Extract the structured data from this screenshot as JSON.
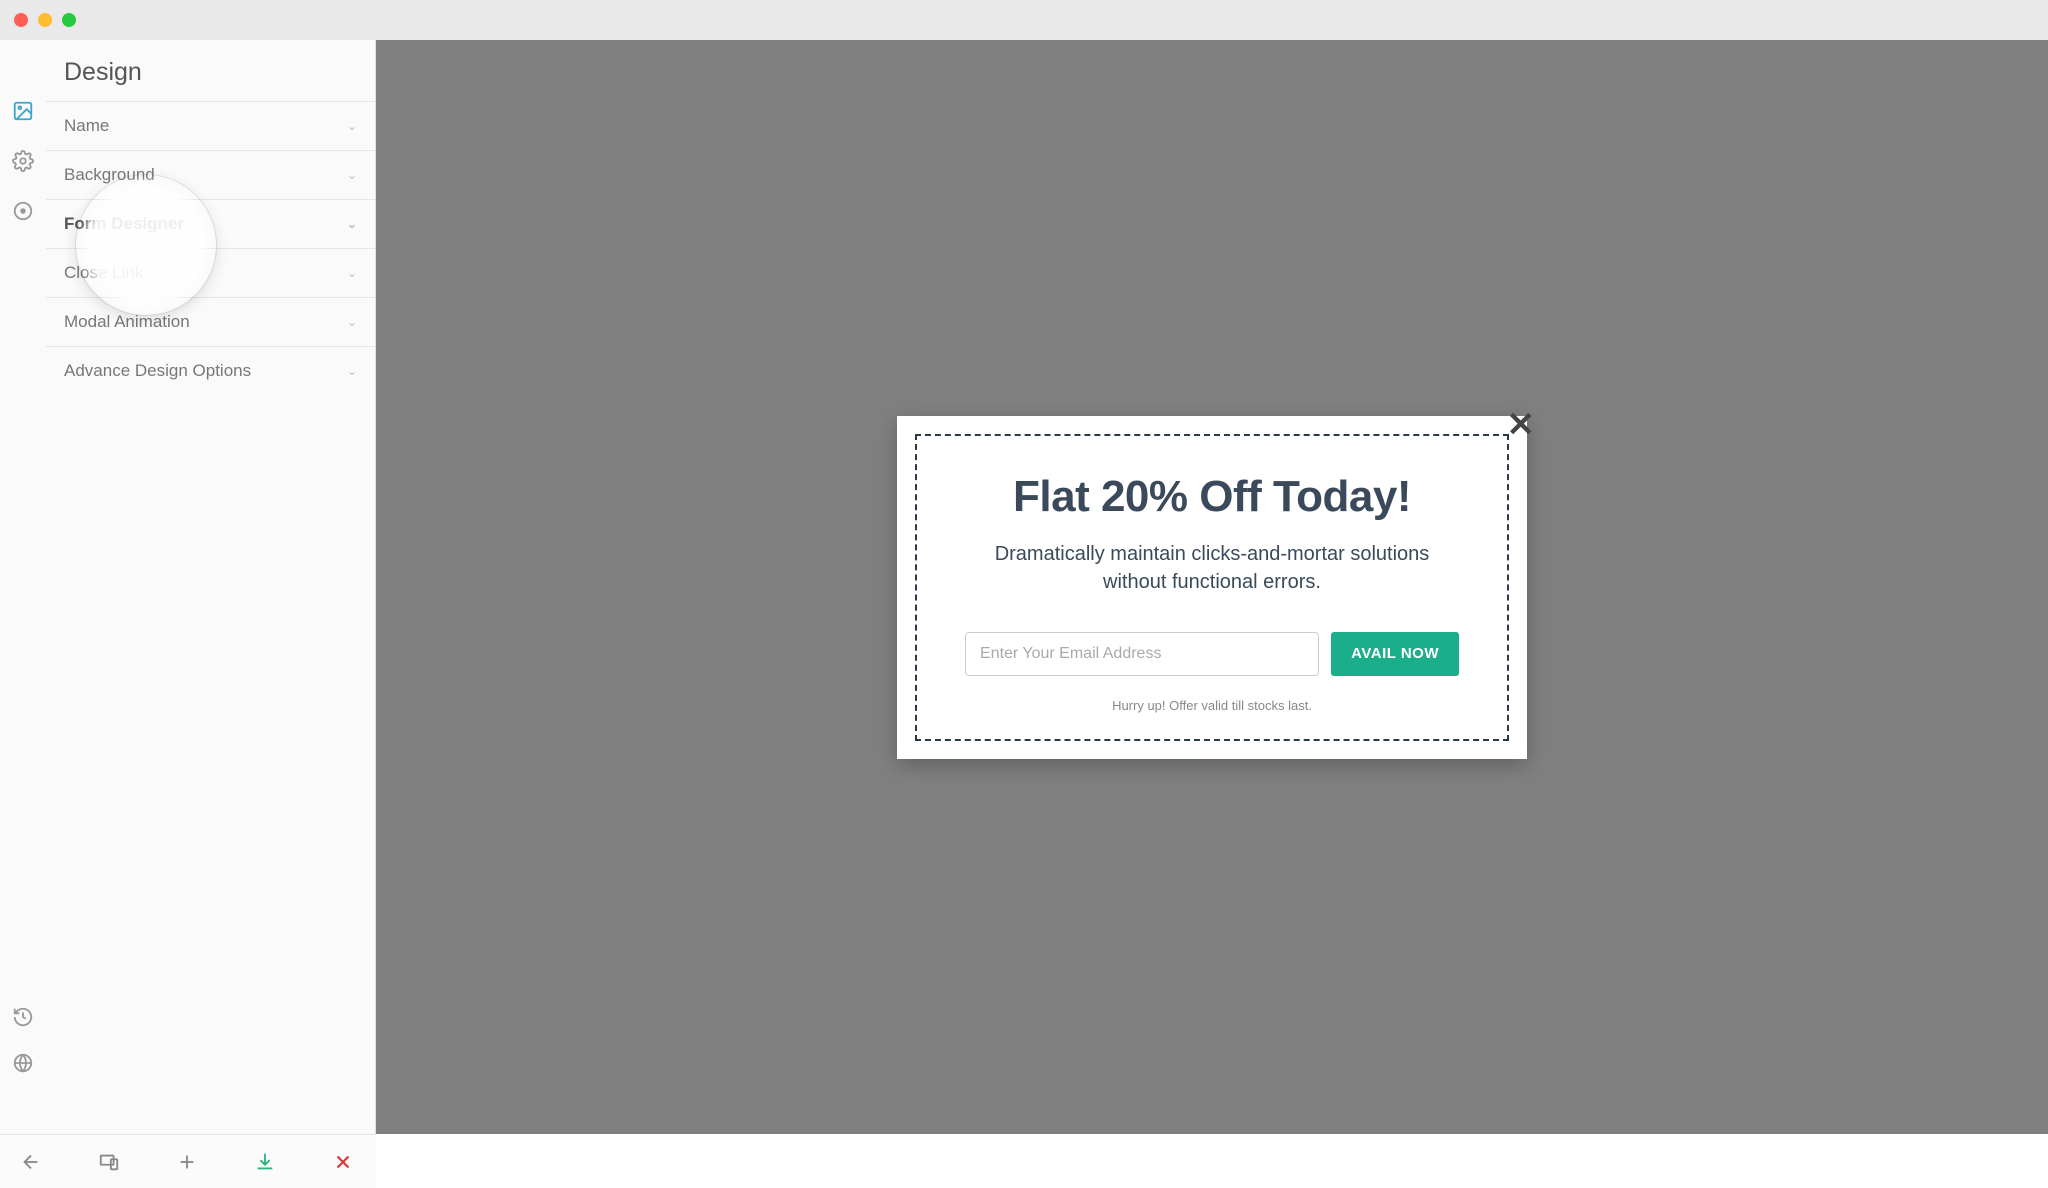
{
  "sidebar": {
    "title": "Design",
    "items": [
      {
        "label": "Name"
      },
      {
        "label": "Background"
      },
      {
        "label": "Form Designer"
      },
      {
        "label": "Close Link"
      },
      {
        "label": "Modal Animation"
      },
      {
        "label": "Advance Design Options"
      }
    ],
    "highlighted": "Form Designer"
  },
  "iconrail": {
    "top": [
      "image-icon",
      "gear-icon",
      "target-icon"
    ],
    "bottom": [
      "history-icon",
      "globe-icon"
    ]
  },
  "modal": {
    "title": "Flat 20% Off Today!",
    "subtitle": "Dramatically maintain clicks-and-mortar solutions without functional errors.",
    "email_placeholder": "Enter Your Email Address",
    "cta_label": "AVAIL NOW",
    "footer": "Hurry up! Offer valid till stocks last."
  },
  "footer": {
    "actions": [
      "back",
      "responsive",
      "add",
      "save",
      "close"
    ]
  }
}
